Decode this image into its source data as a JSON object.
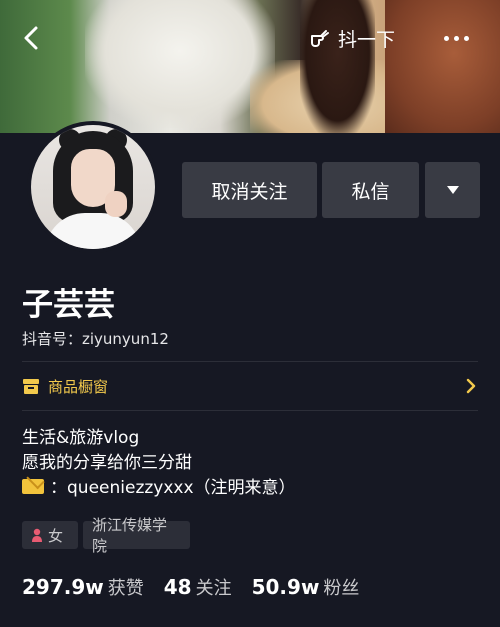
{
  "header": {
    "shake_label": "抖一下"
  },
  "actions": {
    "unfollow_label": "取消关注",
    "message_label": "私信"
  },
  "profile": {
    "name": "子芸芸",
    "douyin_id": "抖音号：ziyunyun12",
    "shop_label": "商品橱窗",
    "bio_line1": "生活&旅游vlog",
    "bio_line2": "愿我的分享给你三分甜",
    "bio_line3": "：queeniezzyxxx（注明来意）",
    "gender": "女",
    "school": "浙江传媒学院"
  },
  "stats": [
    {
      "value": "297.9w",
      "label": "获赞"
    },
    {
      "value": "48",
      "label": "关注"
    },
    {
      "value": "50.9w",
      "label": "粉丝"
    }
  ],
  "icons": {
    "back": "back-chevron-icon",
    "shake": "shake-hand-icon",
    "more": "more-dots-icon",
    "dropdown": "dropdown-triangle-icon",
    "shop": "shop-window-icon",
    "shop_chevron": "chevron-right-icon",
    "mail": "mail-envelope-icon",
    "gender": "female-icon"
  },
  "colors": {
    "background": "#161823",
    "button": "#393b44",
    "shop_accent": "#f2c94c",
    "tag_bg": "#2c2e38"
  }
}
